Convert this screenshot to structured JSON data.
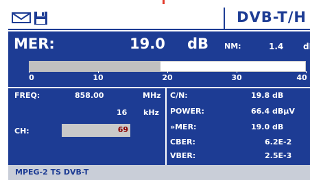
{
  "header": {
    "mode": "DVB-T/H",
    "icons": [
      "envelope-icon",
      "floppy-disk-icon"
    ]
  },
  "main_measure": {
    "label": "MER:",
    "value": "19.0",
    "unit": "dB",
    "nm_label": "NM:",
    "nm_value": "1.4",
    "nm_unit": "dB"
  },
  "bar": {
    "level_db": 19.0,
    "min": 0,
    "max": 40,
    "ticks": [
      "0",
      "10",
      "20",
      "30",
      "40"
    ]
  },
  "left_panel": {
    "freq_label": "FREQ:",
    "freq_value": "858.00",
    "freq_unit": "MHz",
    "step_value": "16",
    "step_unit": "kHz",
    "ch_label": "CH:",
    "ch_value": "69"
  },
  "right_panel": {
    "rows": [
      {
        "label": "C/N:",
        "value": "19.8 dB"
      },
      {
        "label": "POWER:",
        "value": "66.4 dBµV"
      },
      {
        "label": "»MER:",
        "value": "19.0 dB"
      },
      {
        "label": "CBER:",
        "value": "6.2E-2"
      },
      {
        "label": "VBER:",
        "value": "2.5E-3"
      }
    ]
  },
  "footer": {
    "status": "MPEG-2 TS DVB-T"
  },
  "colors": {
    "screen_background": "#1d3c94",
    "foreground": "#ffffff",
    "bar_fill": "#c0c0c0",
    "channel_value": "#8b0000",
    "indicator": "#e23a2a"
  }
}
